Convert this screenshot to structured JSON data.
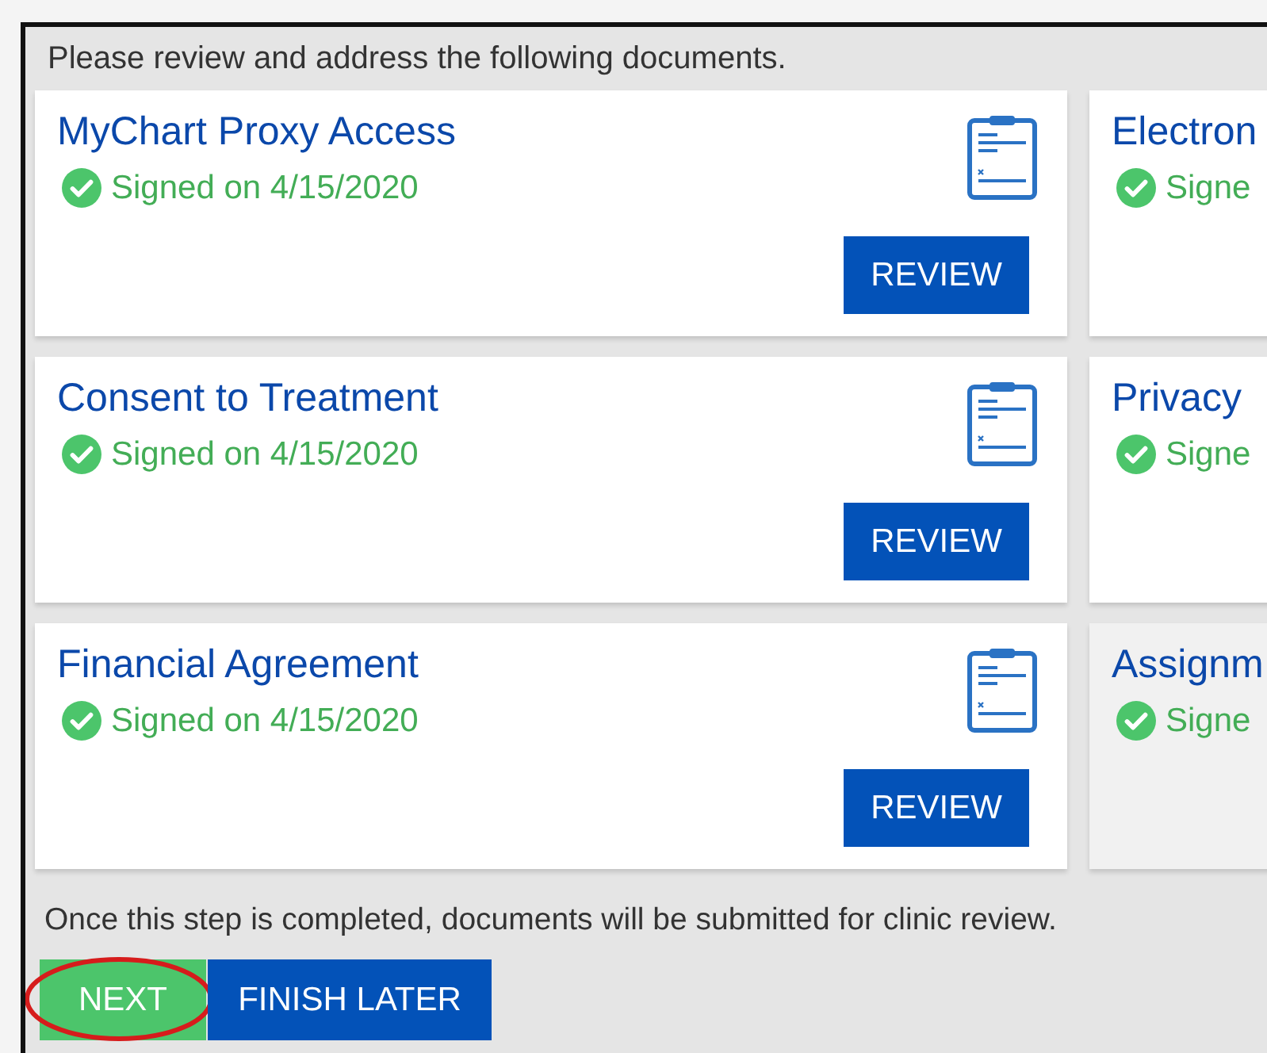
{
  "intro": "Please review and address the following documents.",
  "documents": [
    {
      "title": "MyChart Proxy Access",
      "status": "Signed on 4/15/2020",
      "signed": true,
      "action": "REVIEW",
      "dimmed": false
    },
    {
      "title": "Electron",
      "status": "Signe",
      "signed": true,
      "dimmed": false
    },
    {
      "title": "Consent to Treatment",
      "status": "Signed on 4/15/2020",
      "signed": true,
      "action": "REVIEW",
      "dimmed": false
    },
    {
      "title": "Privacy",
      "status": "Signe",
      "signed": true,
      "dimmed": false
    },
    {
      "title": "Financial Agreement",
      "status": "Signed on 4/15/2020",
      "signed": true,
      "action": "REVIEW",
      "dimmed": false
    },
    {
      "title": "Assignm",
      "status": "Signe",
      "signed": true,
      "dimmed": true
    }
  ],
  "note": "Once this step is completed, documents will be submitted for clinic review.",
  "buttons": [
    {
      "label": "NEXT",
      "kind": "primary",
      "circled": true
    },
    {
      "label": "FINISH LATER",
      "kind": "secondary",
      "circled": false
    }
  ]
}
